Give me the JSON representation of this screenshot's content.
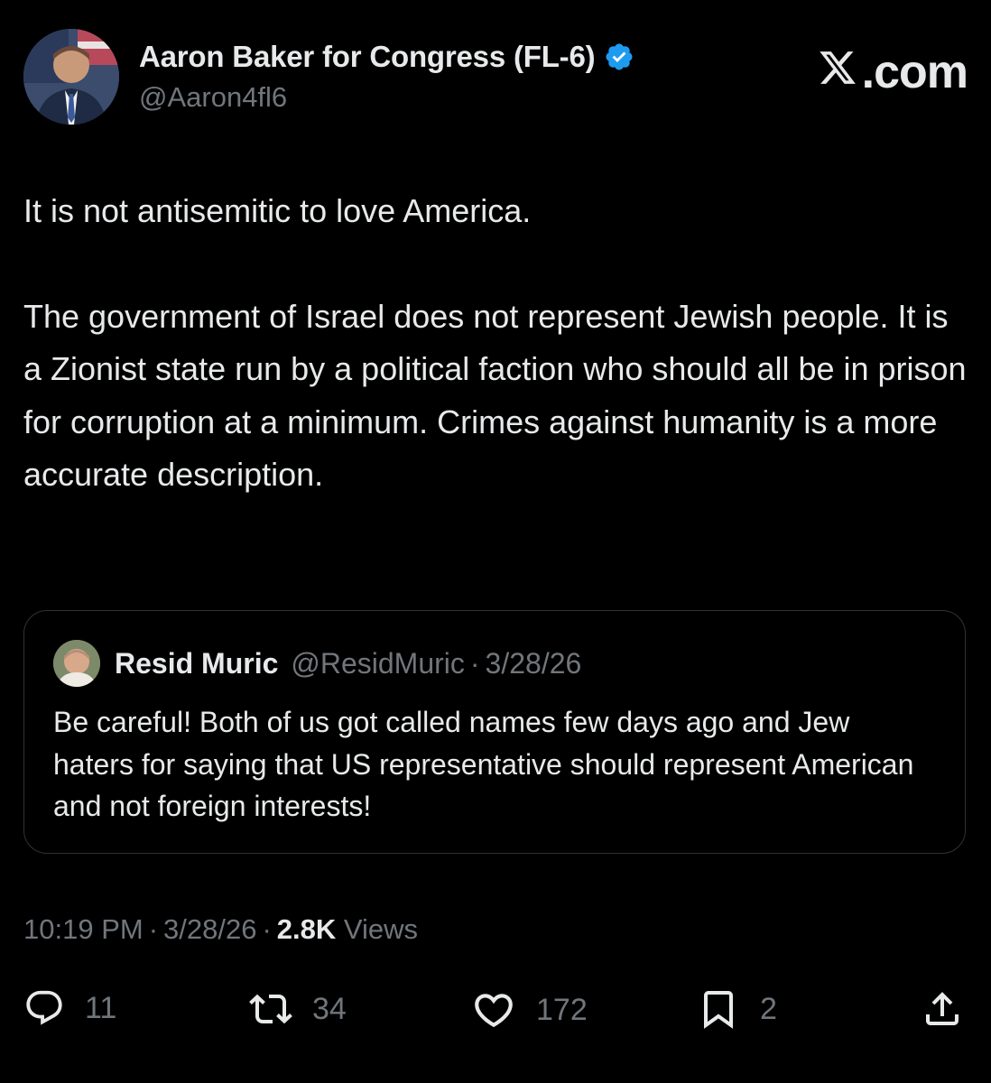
{
  "header": {
    "display_name": "Aaron Baker for Congress (FL-6)",
    "handle": "@Aaron4fl6",
    "verified_icon": "verified-badge-icon",
    "site_logo": ".com",
    "site_logo_icon": "x-logo-icon"
  },
  "post": {
    "paragraph_1": "It is not antisemitic to love America.",
    "paragraph_2": "The government of Israel does not represent Jewish people. It is a Zionist state run by a political faction who should all be in prison for corruption at a minimum. Crimes against humanity is a more accurate description."
  },
  "quoted_post": {
    "name": "Resid Muric",
    "handle": "@ResidMuric",
    "separator": "·",
    "date": "3/28/26",
    "text": "Be careful! Both of us got called names few days ago and Jew haters for saying that US representative should represent American and not foreign interests!"
  },
  "meta": {
    "time": "10:19 PM",
    "separator": "·",
    "date": "3/28/26",
    "views_count": "2.8K",
    "views_label": "Views"
  },
  "actions": {
    "replies": "11",
    "reposts": "34",
    "likes": "172",
    "bookmarks": "2"
  },
  "colors": {
    "background": "#000000",
    "text_primary": "#e7e9ea",
    "text_secondary": "#71767b",
    "border": "#2f3336",
    "verified": "#1d9bf0"
  }
}
